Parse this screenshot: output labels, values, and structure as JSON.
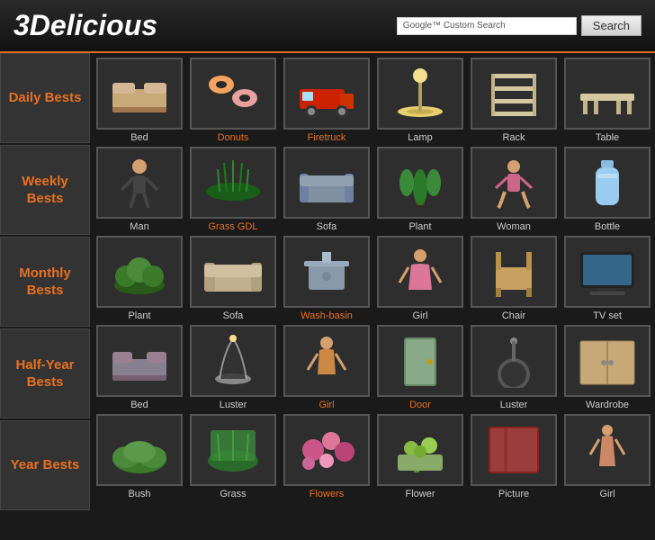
{
  "header": {
    "logo_3": "3",
    "logo_delicious": "Delicious",
    "google_label": "Google™ Custom Search",
    "search_placeholder": "",
    "search_button_label": "Search"
  },
  "sidebar": {
    "buttons": [
      {
        "id": "daily",
        "label": "Daily\nBests"
      },
      {
        "id": "weekly",
        "label": "Weekly\nBests"
      },
      {
        "id": "monthly",
        "label": "Monthly\nBests"
      },
      {
        "id": "halfyear",
        "label": "Half-Year\nBests"
      },
      {
        "id": "year",
        "label": "Year\nBests"
      }
    ]
  },
  "rows": [
    {
      "row_id": "daily",
      "items": [
        {
          "label": "Bed",
          "color": "white",
          "shape": "bed"
        },
        {
          "label": "Donuts",
          "color": "orange",
          "shape": "donuts"
        },
        {
          "label": "Firetruck",
          "color": "orange",
          "shape": "firetruck"
        },
        {
          "label": "Lamp",
          "color": "white",
          "shape": "lamp"
        },
        {
          "label": "Rack",
          "color": "white",
          "shape": "rack"
        },
        {
          "label": "Table",
          "color": "white",
          "shape": "table"
        }
      ]
    },
    {
      "row_id": "weekly",
      "items": [
        {
          "label": "Man",
          "color": "white",
          "shape": "man"
        },
        {
          "label": "Grass GDL",
          "color": "orange",
          "shape": "grass"
        },
        {
          "label": "Sofa",
          "color": "white",
          "shape": "sofa"
        },
        {
          "label": "Plant",
          "color": "white",
          "shape": "plant"
        },
        {
          "label": "Woman",
          "color": "white",
          "shape": "woman"
        },
        {
          "label": "Bottle",
          "color": "white",
          "shape": "bottle"
        }
      ]
    },
    {
      "row_id": "monthly",
      "items": [
        {
          "label": "Plant",
          "color": "white",
          "shape": "plant2"
        },
        {
          "label": "Sofa",
          "color": "white",
          "shape": "sofa2"
        },
        {
          "label": "Wash-basin",
          "color": "orange",
          "shape": "washbasin"
        },
        {
          "label": "Girl",
          "color": "white",
          "shape": "girl"
        },
        {
          "label": "Chair",
          "color": "white",
          "shape": "chair"
        },
        {
          "label": "TV set",
          "color": "white",
          "shape": "tvset"
        }
      ]
    },
    {
      "row_id": "halfyear",
      "items": [
        {
          "label": "Bed",
          "color": "white",
          "shape": "bed2"
        },
        {
          "label": "Luster",
          "color": "white",
          "shape": "luster"
        },
        {
          "label": "Girl",
          "color": "orange",
          "shape": "girl2"
        },
        {
          "label": "Door",
          "color": "orange",
          "shape": "door"
        },
        {
          "label": "Luster",
          "color": "white",
          "shape": "luster2"
        },
        {
          "label": "Wardrobe",
          "color": "white",
          "shape": "wardrobe"
        }
      ]
    },
    {
      "row_id": "year",
      "items": [
        {
          "label": "Bush",
          "color": "white",
          "shape": "bush"
        },
        {
          "label": "Grass",
          "color": "white",
          "shape": "grass2"
        },
        {
          "label": "Flowers",
          "color": "orange",
          "shape": "flowers"
        },
        {
          "label": "Flower",
          "color": "white",
          "shape": "flower"
        },
        {
          "label": "Picture",
          "color": "white",
          "shape": "picture"
        },
        {
          "label": "Girl",
          "color": "white",
          "shape": "girl3"
        }
      ]
    }
  ]
}
